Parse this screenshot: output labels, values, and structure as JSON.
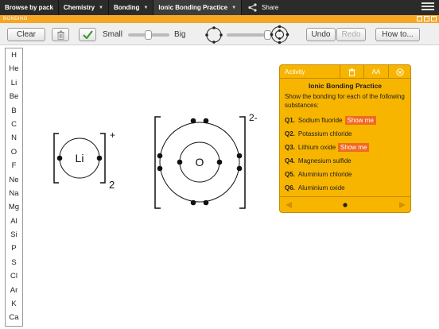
{
  "topnav": {
    "crumbs": [
      "Browse by pack",
      "Chemistry",
      "Bonding",
      "Ionic Bonding Practice"
    ],
    "share": "Share"
  },
  "titlebar": {
    "title": "BONDING"
  },
  "toolbar": {
    "clear": "Clear",
    "small": "Small",
    "big": "Big",
    "undo": "Undo",
    "redo": "Redo",
    "howto": "How to..."
  },
  "elements": [
    "H",
    "He",
    "Li",
    "Be",
    "B",
    "C",
    "N",
    "O",
    "F",
    "Ne",
    "Na",
    "Mg",
    "Al",
    "Si",
    "P",
    "S",
    "Cl",
    "Ar",
    "K",
    "Ca"
  ],
  "diagram": {
    "lithium": {
      "symbol": "Li",
      "charge": "+",
      "count": "2"
    },
    "oxygen": {
      "symbol": "O",
      "charge": "2-"
    }
  },
  "activity": {
    "tab": "Activity",
    "text_size": "AA",
    "heading": "Ionic Bonding Practice",
    "intro": "Show the bonding for each of the following substances:",
    "questions": [
      {
        "num": "Q1.",
        "text": "Sodium fluoride",
        "show": "Show me"
      },
      {
        "num": "Q2.",
        "text": "Potassium chloride",
        "show": ""
      },
      {
        "num": "Q3.",
        "text": "Lithium oxide",
        "show": "Show me"
      },
      {
        "num": "Q4.",
        "text": "Magnesium sulfide",
        "show": ""
      },
      {
        "num": "Q5.",
        "text": "Aluminium chloride",
        "show": ""
      },
      {
        "num": "Q6.",
        "text": "Aluminium oxide",
        "show": ""
      }
    ]
  },
  "colors": {
    "accent": "#f7b500",
    "highlight": "#f06a22"
  }
}
